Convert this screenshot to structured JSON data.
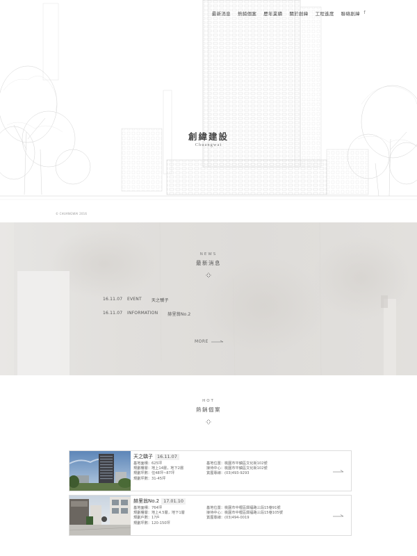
{
  "header": {
    "nav": [
      "最新消息",
      "熱銷個案",
      "歷年業績",
      "關於創緯",
      "工程進度",
      "聯絡創緯"
    ],
    "social_icon": "facebook-icon",
    "social_label": "f"
  },
  "hero": {
    "title": "創緯建設",
    "subtitle": "Chuangwai",
    "copyright": "© CHUANGWAI 2016"
  },
  "news": {
    "label_en": "NEWS",
    "label_zh": "最新消息",
    "items": [
      {
        "date": "16.11.07",
        "category": "EVENT",
        "title": "天之驕子"
      },
      {
        "date": "16.11.07",
        "category": "INFORMATION",
        "title": "赫里翁No.2"
      }
    ],
    "more_label": "MORE"
  },
  "hot": {
    "label_en": "HOT",
    "label_zh": "熱銷個案",
    "cards": [
      {
        "name": "天之驕子",
        "date": "16.11.07",
        "specs_left": [
          "基地面積：625坪",
          "規劃樓層：地上14層，地下2層",
          "規劃坪數：住48坪~87坪",
          "規劃坪數：31-45坪"
        ],
        "specs_right": [
          "基地位置：桃園市平鎮區文化街102號",
          "接待中心：桃園市平鎮區文化街102號",
          "賞屋專線：(03)493-9293"
        ]
      },
      {
        "name": "赫里翁No.2",
        "date": "17.01.10",
        "specs_left": [
          "基地面積：764坪",
          "規劃樓層：地上4.5層，地下1層",
          "規劃戶數：17戶",
          "規劃坪數：120-150坪"
        ],
        "specs_right": [
          "基地位置：桃園市中壢區興福路三段15巷91號",
          "接待中心：桃園市中壢區興福路三段15巷105號",
          "賞屋專線：(03)494-0019"
        ]
      }
    ]
  },
  "colors": {
    "accent": "#555555",
    "border": "#dcdcdc",
    "news_bg": "#e4e2df"
  }
}
